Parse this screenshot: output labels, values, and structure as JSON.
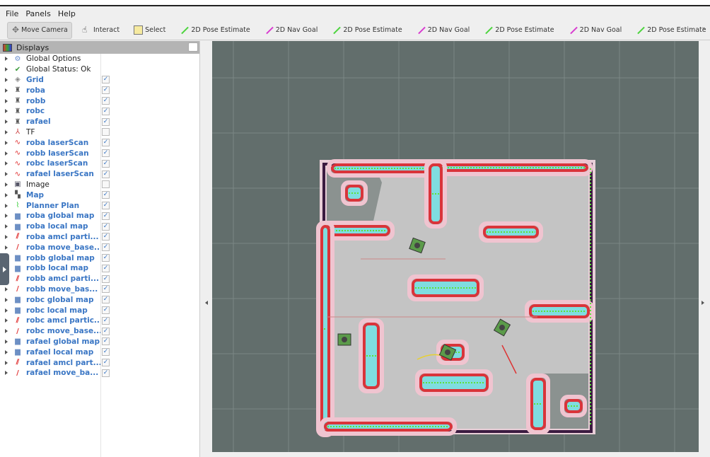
{
  "menu": [
    "File",
    "Panels",
    "Help"
  ],
  "toolbar": {
    "tools": [
      {
        "label": "Move Camera",
        "icon": "move-camera-icon",
        "active": true
      },
      {
        "label": "Interact",
        "icon": "hand-icon"
      },
      {
        "label": "Select",
        "icon": "select-box-icon"
      },
      {
        "label": "2D Pose Estimate",
        "icon": "pose-arrow-icon",
        "color": "#4cd43c"
      },
      {
        "label": "2D Nav Goal",
        "icon": "goal-arrow-icon",
        "color": "#d83cd0"
      },
      {
        "label": "2D Pose Estimate",
        "icon": "pose-arrow-icon",
        "color": "#4cd43c"
      },
      {
        "label": "2D Nav Goal",
        "icon": "goal-arrow-icon",
        "color": "#d83cd0"
      },
      {
        "label": "2D Pose Estimate",
        "icon": "pose-arrow-icon",
        "color": "#4cd43c"
      },
      {
        "label": "2D Nav Goal",
        "icon": "goal-arrow-icon",
        "color": "#d83cd0"
      },
      {
        "label": "2D Pose Estimate",
        "icon": "pose-arrow-icon",
        "color": "#4cd43c"
      }
    ],
    "more": "»"
  },
  "displays": {
    "title": "Displays",
    "items": [
      {
        "label": "Global Options",
        "icon": "gear-icon",
        "checked": null
      },
      {
        "label": "Global Status: Ok",
        "icon": "check-icon",
        "checked": null
      },
      {
        "label": "Grid",
        "icon": "grid-icon",
        "checked": true
      },
      {
        "label": "roba",
        "icon": "robot-model-icon",
        "checked": true
      },
      {
        "label": "robb",
        "icon": "robot-model-icon",
        "checked": true
      },
      {
        "label": "robc",
        "icon": "robot-model-icon",
        "checked": true
      },
      {
        "label": "rafael",
        "icon": "robot-model-icon",
        "checked": true
      },
      {
        "label": "TF",
        "icon": "tf-axes-icon",
        "checked": false
      },
      {
        "label": "roba laserScan",
        "icon": "laserscan-icon",
        "checked": true
      },
      {
        "label": "robb laserScan",
        "icon": "laserscan-icon",
        "checked": true
      },
      {
        "label": "robc laserScan",
        "icon": "laserscan-icon",
        "checked": true
      },
      {
        "label": "rafael laserScan",
        "icon": "laserscan-icon",
        "checked": true
      },
      {
        "label": "Image",
        "icon": "image-icon",
        "checked": false
      },
      {
        "label": "Map",
        "icon": "map-icon",
        "checked": true
      },
      {
        "label": "Planner Plan",
        "icon": "path-icon",
        "checked": true
      },
      {
        "label": "roba global map",
        "icon": "folder-icon",
        "checked": true
      },
      {
        "label": "roba local map",
        "icon": "folder-icon",
        "checked": true
      },
      {
        "label": "roba amcl parti...",
        "icon": "pose-array-icon",
        "checked": true
      },
      {
        "label": "roba move_base...",
        "icon": "pose-icon",
        "checked": true
      },
      {
        "label": "robb global map",
        "icon": "folder-icon",
        "checked": true
      },
      {
        "label": "robb local map",
        "icon": "folder-icon",
        "checked": true
      },
      {
        "label": "robb amcl parti...",
        "icon": "pose-array-icon",
        "checked": true
      },
      {
        "label": "robb move_bas...",
        "icon": "pose-icon",
        "checked": true
      },
      {
        "label": "robc global map",
        "icon": "folder-icon",
        "checked": true
      },
      {
        "label": "robc local map",
        "icon": "folder-icon",
        "checked": true
      },
      {
        "label": "robc amcl partic...",
        "icon": "pose-array-icon",
        "checked": true
      },
      {
        "label": "robc move_base...",
        "icon": "pose-icon",
        "checked": true
      },
      {
        "label": "rafael global map",
        "icon": "folder-icon",
        "checked": true
      },
      {
        "label": "rafael local map",
        "icon": "folder-icon",
        "checked": true
      },
      {
        "label": "rafael amcl part...",
        "icon": "pose-array-icon",
        "checked": true
      },
      {
        "label": "rafael move_ba...",
        "icon": "pose-icon",
        "checked": true
      }
    ]
  },
  "colors": {
    "background": "#626e6c",
    "floor": "#c4c4c4",
    "inflation": "#d9343a",
    "costmap": "#7fdde0",
    "scan": "#5ee03a"
  }
}
